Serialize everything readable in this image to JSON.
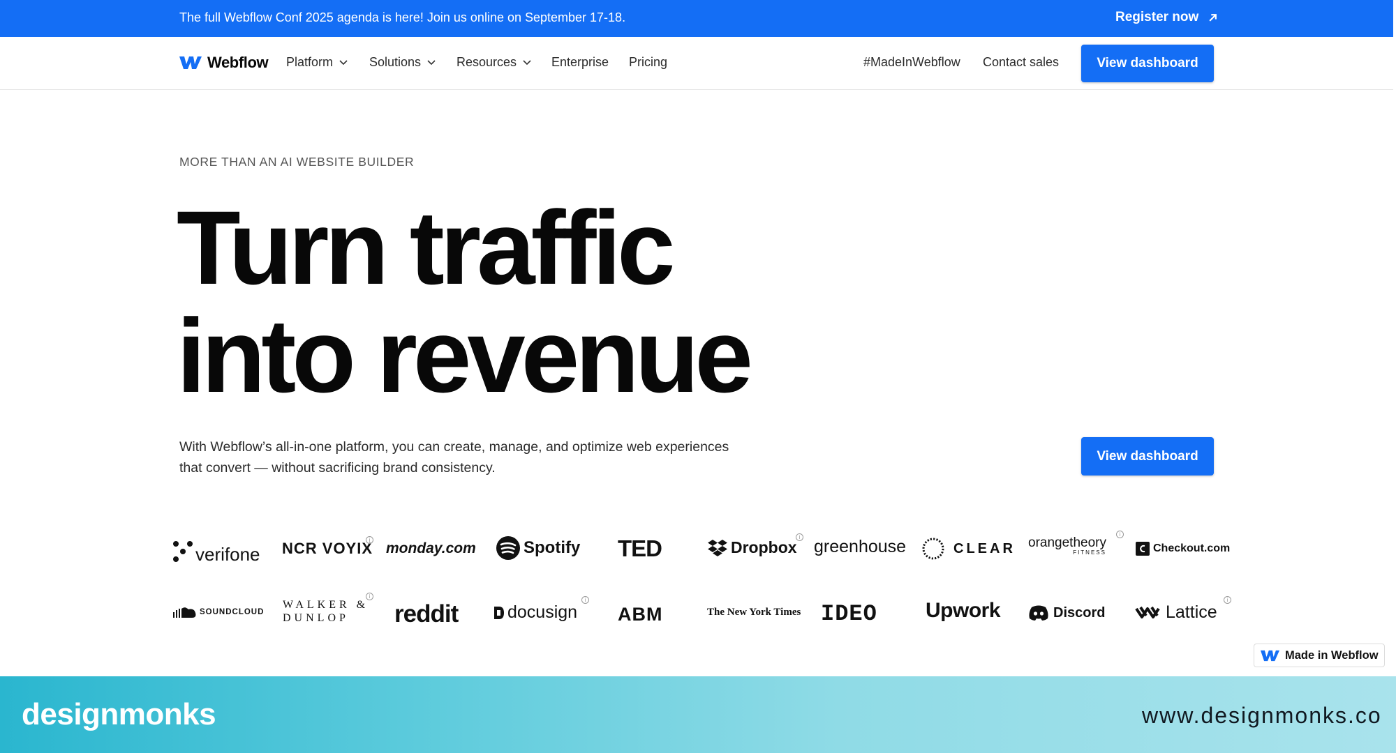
{
  "banner": {
    "text": "The full Webflow Conf 2025 agenda is here! Join us online on September 17-18.",
    "link_label": "Register now"
  },
  "nav": {
    "brand": "Webflow",
    "items": [
      {
        "label": "Platform"
      },
      {
        "label": "Solutions"
      },
      {
        "label": "Resources"
      },
      {
        "label": "Enterprise"
      },
      {
        "label": "Pricing"
      }
    ],
    "right_links": [
      "#MadeInWebflow",
      "Contact sales"
    ],
    "cta_label": "View dashboard"
  },
  "hero": {
    "eyebrow": "MORE THAN AN AI WEBSITE BUILDER",
    "headline_line1": "Turn traffic",
    "headline_line2": "into revenue",
    "subtext_line1": "With Webflow’s all-in-one platform, you can create, manage, and optimize web experiences",
    "subtext_line2": "that convert — without sacrificing brand consistency.",
    "cta_label": "View dashboard"
  },
  "logos": {
    "row1": [
      "verifone",
      "NCR VOYIX",
      "monday.com",
      "Spotify",
      "TED",
      "Dropbox",
      "greenhouse",
      "CLEAR",
      "orangetheory",
      "Checkout.com"
    ],
    "row2": [
      "SOUNDCLOUD",
      "WALKER & DUNLOP",
      "reddit",
      "docusign",
      "ABM",
      "The New York Times",
      "IDEO",
      "Upwork",
      "Discord",
      "Lattice"
    ],
    "orangetheory_sub": "FITNESS",
    "walker_line1": "WALKER &",
    "walker_line2": "DUNLOP"
  },
  "badge": {
    "label": "Made in Webflow"
  },
  "watermark": {
    "brand": "designmonks",
    "url": "www.designmonks.co"
  },
  "colors": {
    "accent": "#146ef5",
    "text": "#080808"
  }
}
